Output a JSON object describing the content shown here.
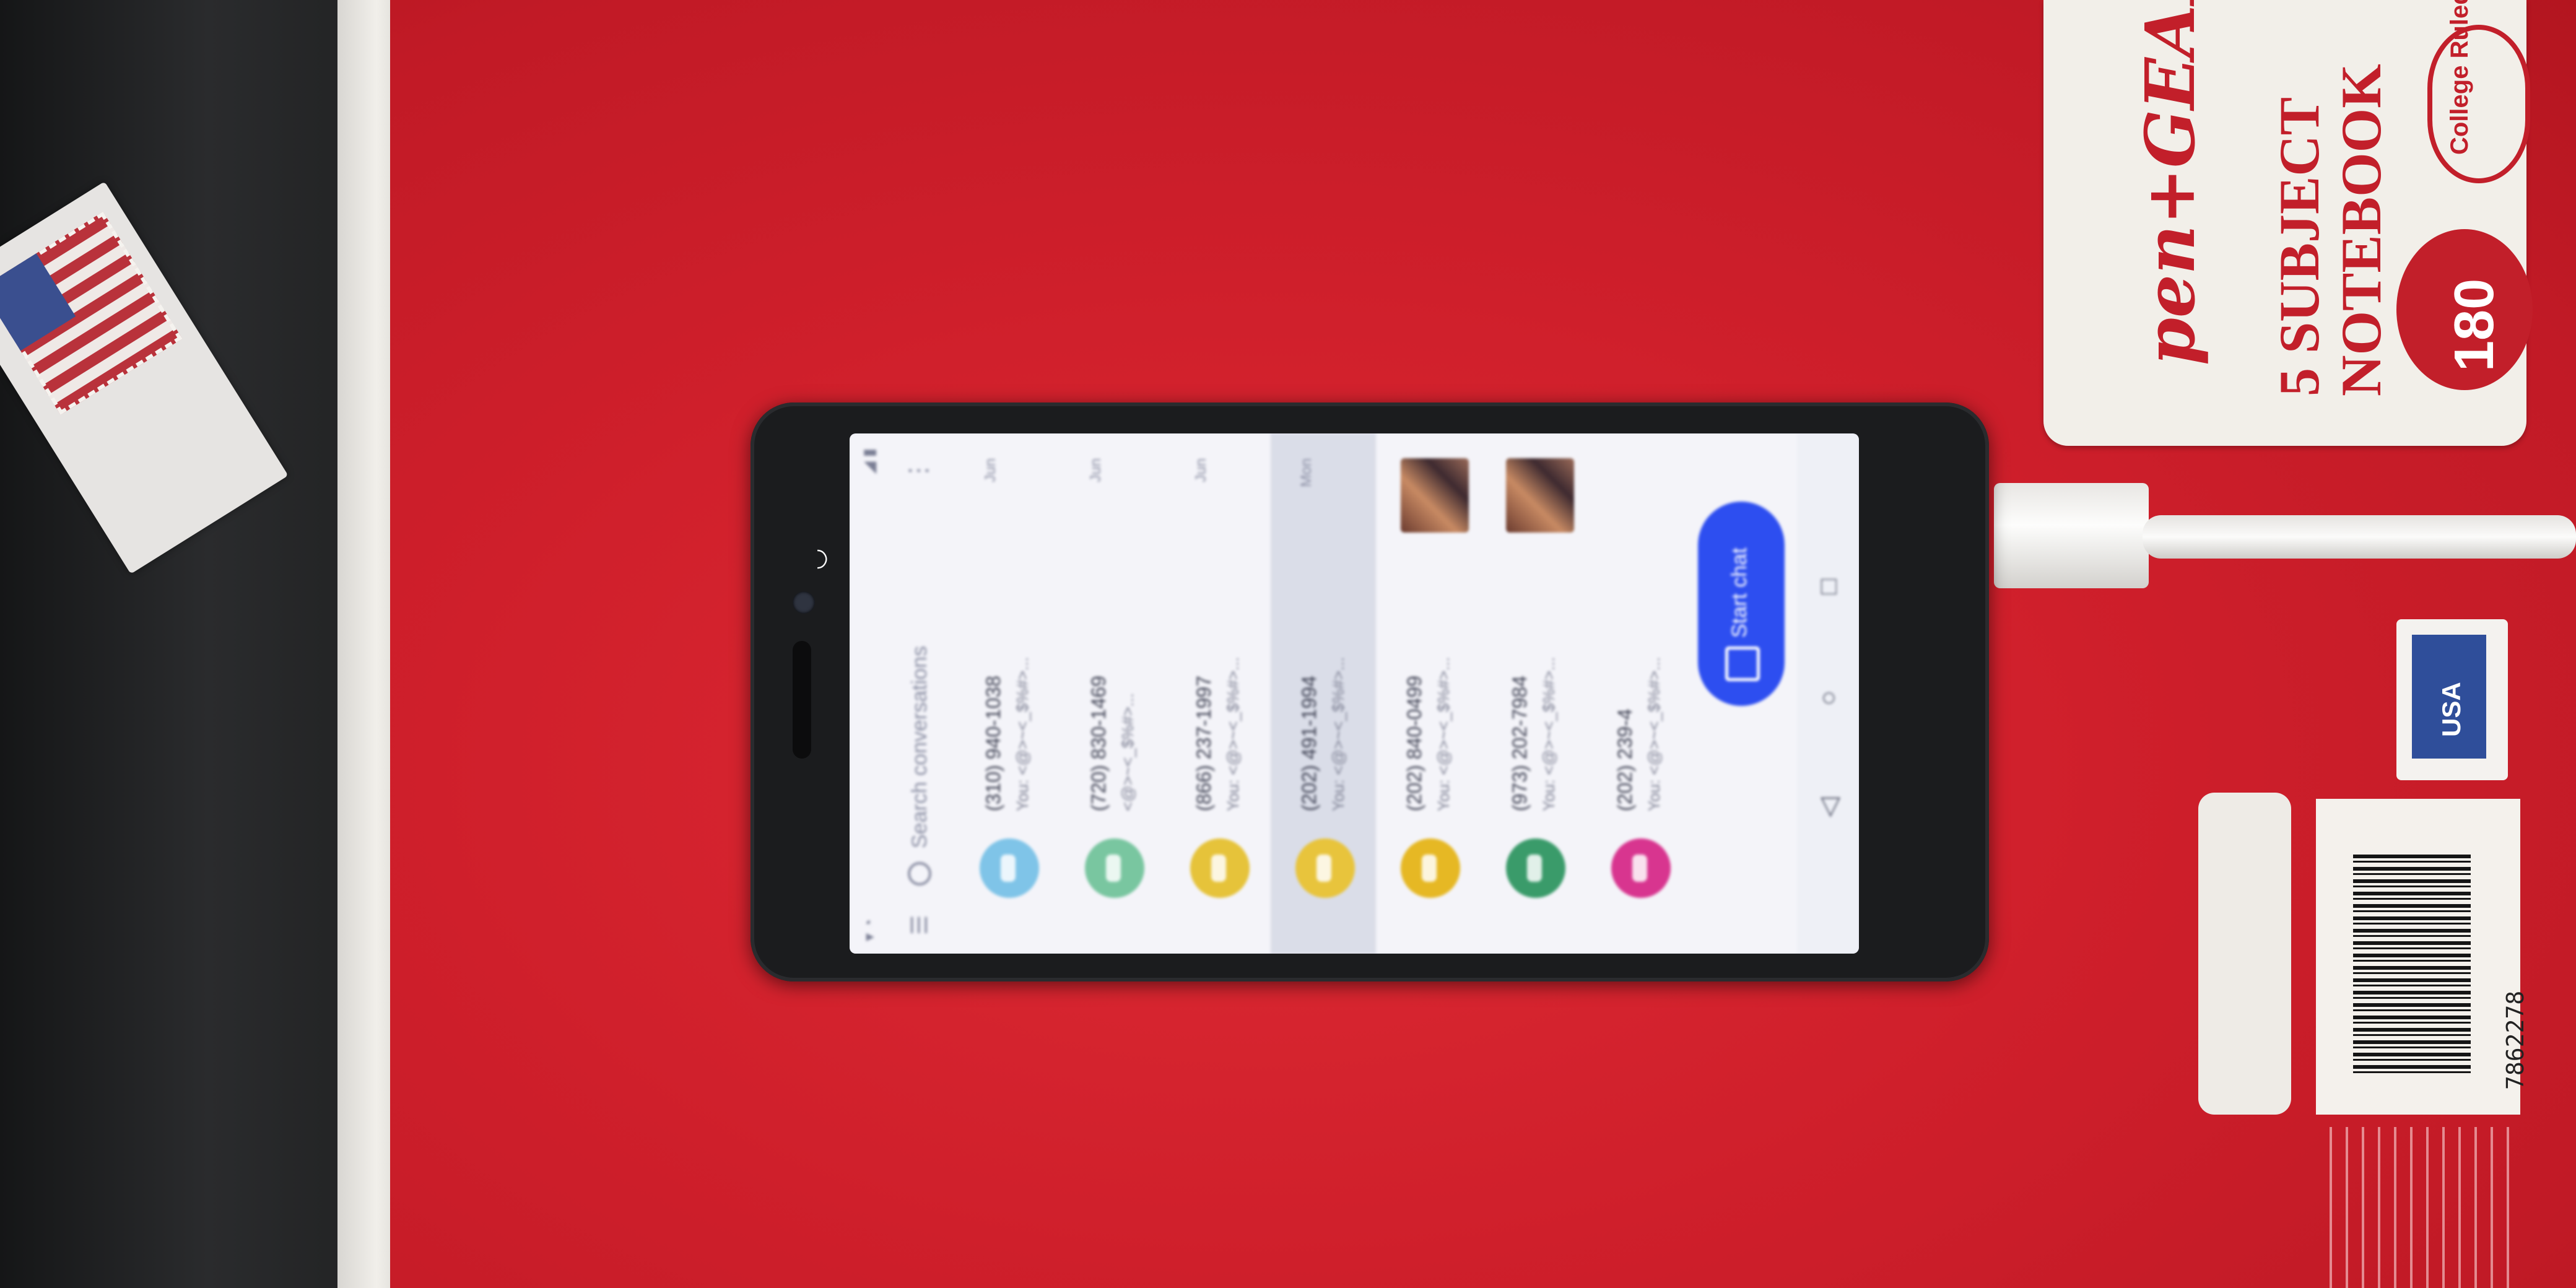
{
  "scene": {
    "notebook": {
      "brand": "pen+GEAR",
      "title_line1": "5 SUBJECT",
      "title_line2": "NOTEBOOK",
      "ruling_badge": "College Ruled",
      "sheets_badge": "180",
      "origin_badge": "USA",
      "barcode_number": "7862278"
    }
  },
  "phone": {
    "app": {
      "search": {
        "placeholder": "Search conversations"
      },
      "conversations": [
        {
          "name": "(310) 940-1038",
          "snippet": "You: <@>~<_$%#>...",
          "time": "Jun",
          "avatar_color": "#7fc4e8"
        },
        {
          "name": "(720) 830-1469",
          "snippet": "<@>~<_$%#>...",
          "time": "Jun",
          "avatar_color": "#79c6a0"
        },
        {
          "name": "(866) 237-1997",
          "snippet": "You: <@>~<_$%#>...",
          "time": "Jun",
          "avatar_color": "#e6c33a"
        },
        {
          "name": "(202) 491-1994",
          "snippet": "You: <@>~<_$%#>...",
          "time": "Mon",
          "avatar_color": "#e8c43c"
        },
        {
          "name": "(202) 840-0499",
          "snippet": "You: <@>~<_$%#>...",
          "time": "",
          "avatar_color": "#e6b824",
          "thumbnail": true
        },
        {
          "name": "(973) 202-7984",
          "snippet": "You: <@>~<_$%#>...",
          "time": "",
          "avatar_color": "#3a9b6a",
          "thumbnail": true
        },
        {
          "name": "(202) 239-4",
          "snippet": "You: <@>~<_$%#>...",
          "time": "",
          "avatar_color": "#d8358f"
        }
      ],
      "fab": {
        "label": "Start chat"
      }
    }
  }
}
